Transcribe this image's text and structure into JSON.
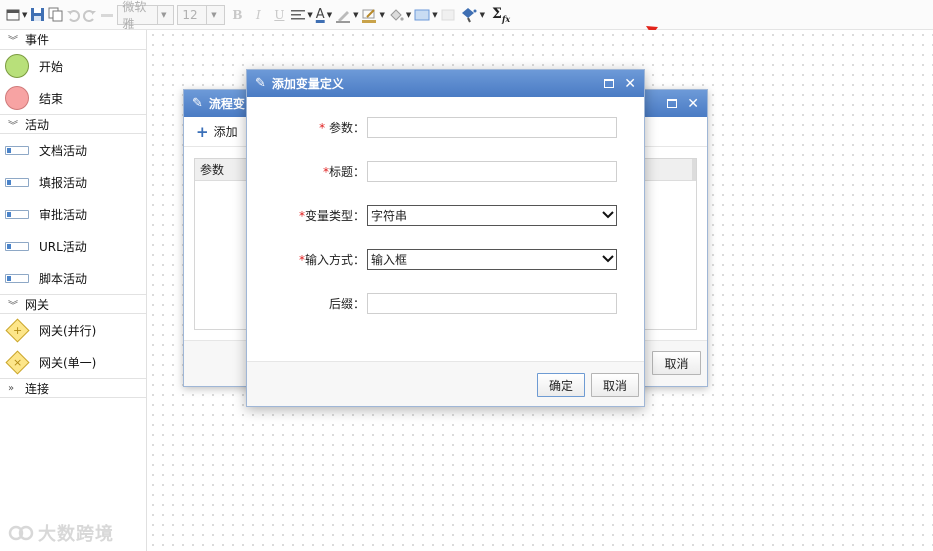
{
  "toolbar": {
    "font_name": "微软雅",
    "font_size": "12",
    "bold": "B",
    "italic": "I",
    "underline": "U",
    "font_color_glyph": "A",
    "sigma": "Σ",
    "sigma_sub": "fx"
  },
  "sidebar": {
    "sections": [
      {
        "title": "事件",
        "items": [
          {
            "label": "开始"
          },
          {
            "label": "结束"
          }
        ]
      },
      {
        "title": "活动",
        "items": [
          {
            "label": "文档活动"
          },
          {
            "label": "填报活动"
          },
          {
            "label": "审批活动"
          },
          {
            "label": "URL活动"
          },
          {
            "label": "脚本活动"
          }
        ]
      },
      {
        "title": "网关",
        "items": [
          {
            "label": "网关(并行)"
          },
          {
            "label": "网关(单一)"
          }
        ]
      },
      {
        "title": "连接",
        "items": []
      }
    ]
  },
  "back_dialog": {
    "title": "流程变",
    "add_label": "添加",
    "grid_header": "参数",
    "cancel_label": "取消"
  },
  "front_dialog": {
    "title": "添加变量定义",
    "fields": [
      {
        "required": "*",
        "label": " 参数：",
        "value": ""
      },
      {
        "required": "*",
        "label": "标题：",
        "value": ""
      },
      {
        "required": "*",
        "label": "变量类型：",
        "value": "字符串"
      },
      {
        "required": "*",
        "label": "输入方式：",
        "value": "输入框"
      },
      {
        "required": "",
        "label": "后缀：",
        "value": ""
      }
    ],
    "ok_label": "确定",
    "cancel_label": "取消"
  },
  "watermark": "大数跨境",
  "colors": {
    "title_bar": "#4a7bc4",
    "annotation_arrow": "#e2231a",
    "required_star": "#e02020"
  }
}
